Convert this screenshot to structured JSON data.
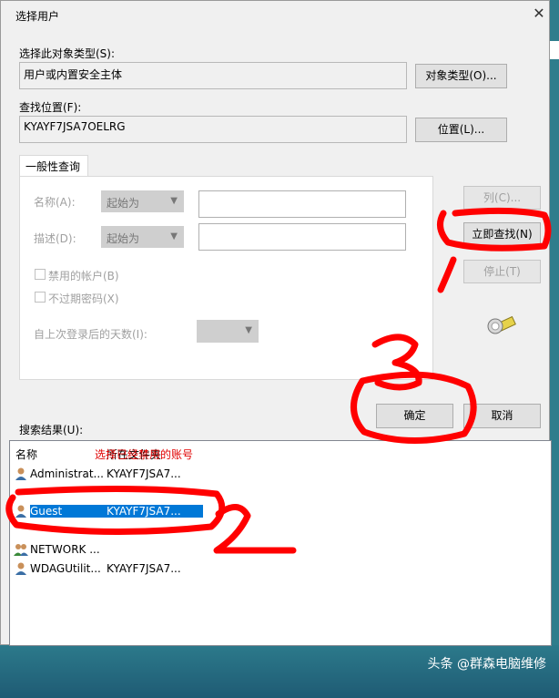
{
  "dialog": {
    "title": "选择用户",
    "close_glyph": "✕",
    "object_type_label": "选择此对象类型(S):",
    "object_type_value": "用户或内置安全主体",
    "object_type_button": "对象类型(O)...",
    "location_label": "查找位置(F):",
    "location_value": "KYAYF7JSA7OELRG",
    "location_button": "位置(L)...",
    "tab_label": "一般性查询",
    "name_label": "名称(A):",
    "desc_label": "描述(D):",
    "starts_with": "起始为",
    "disabled_accounts": "禁用的帐户(B)",
    "no_expire_pwd": "不过期密码(X)",
    "days_since_login": "自上次登录后的天数(I):",
    "columns_button": "列(C)...",
    "find_now_button": "立即查找(N)",
    "stop_button": "停止(T)",
    "ok_button": "确定",
    "cancel_button": "取消",
    "results_label": "搜索结果(U):"
  },
  "results": {
    "headers": [
      "名称",
      "所在文件夹"
    ],
    "rows": [
      {
        "name": "Administrat...",
        "folder": "KYAYF7JSA7..."
      },
      {
        "name": "Guest",
        "folder": "KYAYF7JSA7..."
      },
      {
        "name": "NETWORK ...",
        "folder": ""
      },
      {
        "name": "WDAGUtilit...",
        "folder": "KYAYF7JSA7..."
      }
    ],
    "selected_index": 1
  },
  "annotations": {
    "note": "选择已经禁用的账号",
    "mark_1": "1",
    "mark_2": "2",
    "mark_3": "3"
  },
  "watermark": "头条 @群森电脑维修",
  "colors": {
    "selection": "#0078d7",
    "ink": "#ff0000"
  }
}
